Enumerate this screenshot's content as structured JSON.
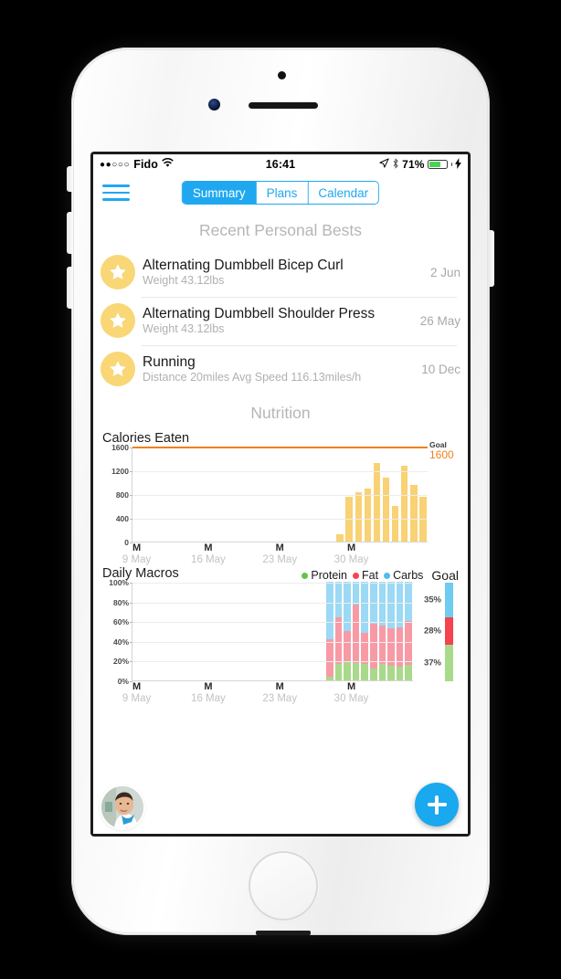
{
  "status_bar": {
    "signal_dots": "●●○○○",
    "carrier": "Fido",
    "wifi_icon": "wifi-icon",
    "time": "16:41",
    "location_icon": "location-arrow-icon",
    "bluetooth_icon": "bluetooth-icon",
    "battery_percent": "71%",
    "battery_level": 71,
    "charging_icon": "lightning-bolt-icon"
  },
  "navbar": {
    "menu_icon": "hamburger-menu-icon",
    "tabs": [
      {
        "label": "Summary",
        "active": true
      },
      {
        "label": "Plans",
        "active": false
      },
      {
        "label": "Calendar",
        "active": false
      }
    ]
  },
  "personal_bests": {
    "heading": "Recent Personal Bests",
    "items": [
      {
        "icon": "star-icon",
        "title": "Alternating Dumbbell Bicep Curl",
        "subtitle": "Weight 43.12lbs",
        "date": "2 Jun"
      },
      {
        "icon": "star-icon",
        "title": "Alternating Dumbbell Shoulder Press",
        "subtitle": "Weight 43.12lbs",
        "date": "26 May"
      },
      {
        "icon": "star-icon",
        "title": "Running",
        "subtitle": "Distance 20miles Avg Speed 116.13miles/h",
        "date": "10 Dec"
      }
    ]
  },
  "nutrition": {
    "heading": "Nutrition"
  },
  "colors": {
    "accent_blue": "#1fa8f0",
    "bar_yellow": "#f8d274",
    "goal_orange": "#f0821e",
    "protein_green": "#a9d98a",
    "fat_red": "#f79aa6",
    "carbs_blue": "#9bd9f5",
    "legend_green": "#63c447",
    "legend_red": "#f5434f",
    "legend_blue": "#4ebdf0",
    "star_badge": "#f9d776"
  },
  "chart_data": [
    {
      "type": "bar",
      "title": "Calories Eaten",
      "xlabel": "",
      "ylabel": "",
      "ylim": [
        0,
        1600
      ],
      "yticks": [
        0,
        400,
        800,
        1200,
        1600
      ],
      "ytick_labels": [
        "0",
        "400",
        "800",
        "1200",
        "1600"
      ],
      "grid": true,
      "goal_label": "Goal",
      "goal_value": "1600",
      "goal": 1600,
      "series": [
        {
          "name": "Calories Eaten",
          "values": [
            0,
            0,
            0,
            0,
            0,
            0,
            0,
            0,
            0,
            0,
            0,
            0,
            0,
            0,
            0,
            0,
            0,
            0,
            0,
            0,
            0,
            0,
            120,
            750,
            830,
            900,
            1330,
            1080,
            600,
            1280,
            950,
            760
          ]
        }
      ],
      "xtick_labels": [
        {
          "dow": "M",
          "date": "9 May",
          "index": 0
        },
        {
          "dow": "M",
          "date": "16 May",
          "index": 7
        },
        {
          "dow": "M",
          "date": "23 May",
          "index": 14
        },
        {
          "dow": "M",
          "date": "30 May",
          "index": 21
        }
      ],
      "n_slots": 32
    },
    {
      "type": "bar",
      "stacked": true,
      "title": "Daily Macros",
      "xlabel": "",
      "ylabel": "",
      "ylim": [
        0,
        100
      ],
      "yticks": [
        0,
        20,
        40,
        60,
        80,
        100
      ],
      "ytick_labels": [
        "0%",
        "20%",
        "40%",
        "60%",
        "80%",
        "100%"
      ],
      "grid": true,
      "legend": [
        {
          "label": "Protein",
          "color": "#63c447"
        },
        {
          "label": "Fat",
          "color": "#f5434f"
        },
        {
          "label": "Carbs",
          "color": "#4ebdf0"
        }
      ],
      "legend_position": "top-right",
      "goal_header": "Goal",
      "goal_segments": [
        {
          "label": "35%",
          "name": "Carbs",
          "value": 35
        },
        {
          "label": "28%",
          "name": "Fat",
          "value": 28
        },
        {
          "label": "37%",
          "name": "Protein",
          "value": 37
        }
      ],
      "series": [
        {
          "name": "Protein",
          "color": "#a9d98a",
          "values": [
            4,
            17,
            19,
            18,
            17,
            12,
            17,
            15,
            14,
            16
          ]
        },
        {
          "name": "Fat",
          "color": "#f79aa6",
          "values": [
            38,
            47,
            31,
            59,
            31,
            45,
            39,
            38,
            40,
            44
          ]
        },
        {
          "name": "Carbs",
          "color": "#9bd9f5",
          "values": [
            58,
            36,
            50,
            23,
            52,
            43,
            44,
            47,
            46,
            40
          ]
        }
      ],
      "bar_start_index": 22,
      "n_slots": 32,
      "xtick_labels": [
        {
          "dow": "M",
          "date": "9 May",
          "index": 0
        },
        {
          "dow": "M",
          "date": "16 May",
          "index": 7
        },
        {
          "dow": "M",
          "date": "23 May",
          "index": 14
        },
        {
          "dow": "M",
          "date": "30 May",
          "index": 21
        }
      ]
    }
  ],
  "floating": {
    "avatar": "user-avatar",
    "add_button_icon": "plus-icon"
  }
}
